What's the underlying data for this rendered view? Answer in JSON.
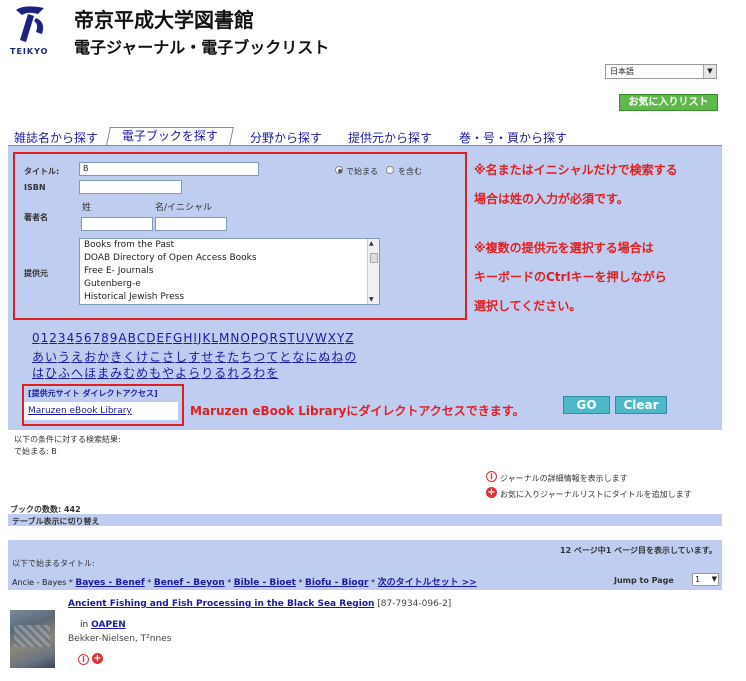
{
  "header": {
    "logo_text": "TEIKYO",
    "library_name": "帝京平成大学図書館",
    "subtitle": "電子ジャーナル・電子ブックリスト"
  },
  "language_select": {
    "value": "日本語"
  },
  "favorites_button": "お気に入りリスト",
  "tabs": [
    {
      "label": "雑誌名から探す",
      "active": false
    },
    {
      "label": "電子ブックを探す",
      "active": true
    },
    {
      "label": "分野から探す",
      "active": false
    },
    {
      "label": "提供元から探す",
      "active": false
    },
    {
      "label": "巻・号・頁から探す",
      "active": false
    }
  ],
  "search_form": {
    "title_label": "タイトル:",
    "title_value": "B",
    "match_options": [
      "で始まる",
      "を含む"
    ],
    "match_selected": "で始まる",
    "isbn_label": "ISBN",
    "author_label": "著者名",
    "author_last_label": "姓",
    "author_first_label": "名/イニシャル",
    "provider_label": "提供元",
    "providers": [
      "Books from the Past",
      "DOAB Directory of Open Access Books",
      "Free E- Journals",
      "Gutenberg-e",
      "Historical Jewish Press"
    ]
  },
  "annotations": {
    "note1_line1": "※名またはイニシャルだけで検索する",
    "note1_line2": "場合は姓の入力が必須です。",
    "note2_line1": "※複数の提供元を選択する場合は",
    "note2_line2": "キーボードのCtrlキーを押しながら",
    "note2_line3": "選択してください。",
    "note3": "Maruzen eBook Libraryにダイレクトアクセスできます。"
  },
  "alpha_nav": {
    "row1": [
      "0",
      "1",
      "2",
      "3",
      "4",
      "5",
      "6",
      "7",
      "8",
      "9",
      "A",
      "B",
      "C",
      "D",
      "E",
      "F",
      "G",
      "H",
      "I",
      "J",
      "K",
      "L",
      "M",
      "N",
      "O",
      "P",
      "Q",
      "R",
      "S",
      "T",
      "U",
      "V",
      "W",
      "X",
      "Y",
      "Z"
    ],
    "row2": [
      "あ",
      "い",
      "う",
      "え",
      "お",
      "か",
      "き",
      "く",
      "け",
      "こ",
      "さ",
      "し",
      "す",
      "せ",
      "そ",
      "た",
      "ち",
      "つ",
      "て",
      "と",
      "な",
      "に",
      "ぬ",
      "ね",
      "の"
    ],
    "row3": [
      "は",
      "ひ",
      "ふ",
      "へ",
      "ほ",
      "ま",
      "み",
      "む",
      "め",
      "も",
      "や",
      "よ",
      "ら",
      "り",
      "る",
      "れ",
      "ろ",
      "わ",
      "を"
    ]
  },
  "direct_access": {
    "title": "[提供元サイト ダイレクトアクセス]",
    "link": "Maruzen eBook Library"
  },
  "buttons": {
    "go": "GO",
    "clear": "Clear"
  },
  "result_summary": {
    "line1": "以下の条件に対する検索結果:",
    "line2": "で始まる: B"
  },
  "legend": {
    "info": "ジャーナルの詳細情報を表示します",
    "add": "お気に入りジャーナルリストにタイトルを追加します"
  },
  "book_count": "ブックの数数: 442",
  "table_toggle": "テーブル表示に切り替え",
  "page_status": "12 ページ中1 ページ目を表示しています。",
  "title_nav": {
    "label": "以下で始まるタイトル:",
    "current": "Ancie - Bayes",
    "links": [
      "Bayes - Benef",
      "Benef - Beyon",
      "Bible - Bioet",
      "Biofu - Biogr"
    ],
    "next": "次のタイトルセット >>"
  },
  "jump_to_page": {
    "label": "Jump to Page",
    "value": "1"
  },
  "result_item": {
    "title": "Ancient Fishing and Fish Processing in the Black Sea Region",
    "isbn": "[87-7934-096-2]",
    "in_label": "in",
    "provider": "OAPEN",
    "author": "Bekker-Nielsen, T²nnes"
  },
  "colors": {
    "panel": "#bfcdf0",
    "annotation_red": "#e02020",
    "link_blue": "#1a1aa6",
    "go_button": "#4db8c8",
    "fav_button": "#5fb84a"
  }
}
